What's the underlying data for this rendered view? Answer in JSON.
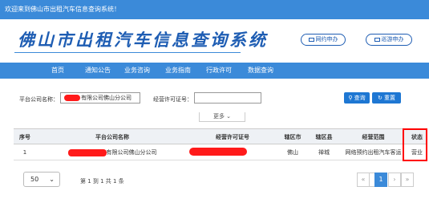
{
  "topbar": {
    "welcome": "欢迎来到佛山市出租汽车信息查询系统！"
  },
  "header": {
    "logo": "佛山市出租汽车信息查询系统",
    "btn_wangyue": "网约申办",
    "btn_xunyou": "巡游申办"
  },
  "nav": {
    "items": [
      "首页",
      "通知公告",
      "业务咨询",
      "业务指南",
      "行政许可",
      "数据查询"
    ]
  },
  "search": {
    "company_label": "平台公司名称：",
    "company_value": "有限公司佛山分公司",
    "license_label": "经营许可证号：",
    "license_value": "",
    "query_label": "查询",
    "reset_label": "重置",
    "more_label": "更多"
  },
  "table": {
    "headers": [
      "序号",
      "平台公司名称",
      "经营许可证号",
      "辖区市",
      "辖区县",
      "经营范围",
      "状态"
    ],
    "rows": [
      {
        "index": "1",
        "company": "有限公司佛山分公司",
        "license": "",
        "city": "佛山",
        "county": "禅城",
        "scope": "网络预约出租汽车客运",
        "status": "营业"
      }
    ]
  },
  "pagination": {
    "page_size": "50",
    "info": "第 1 到 1 共 1 条",
    "first": "«",
    "prev": "‹",
    "current": "1",
    "next": "›",
    "last": "»"
  },
  "colors": {
    "primary": "#3b8ad9",
    "button": "#1e77d3",
    "redaction": "#ff1a1a",
    "highlight_box": "#ff0000"
  }
}
